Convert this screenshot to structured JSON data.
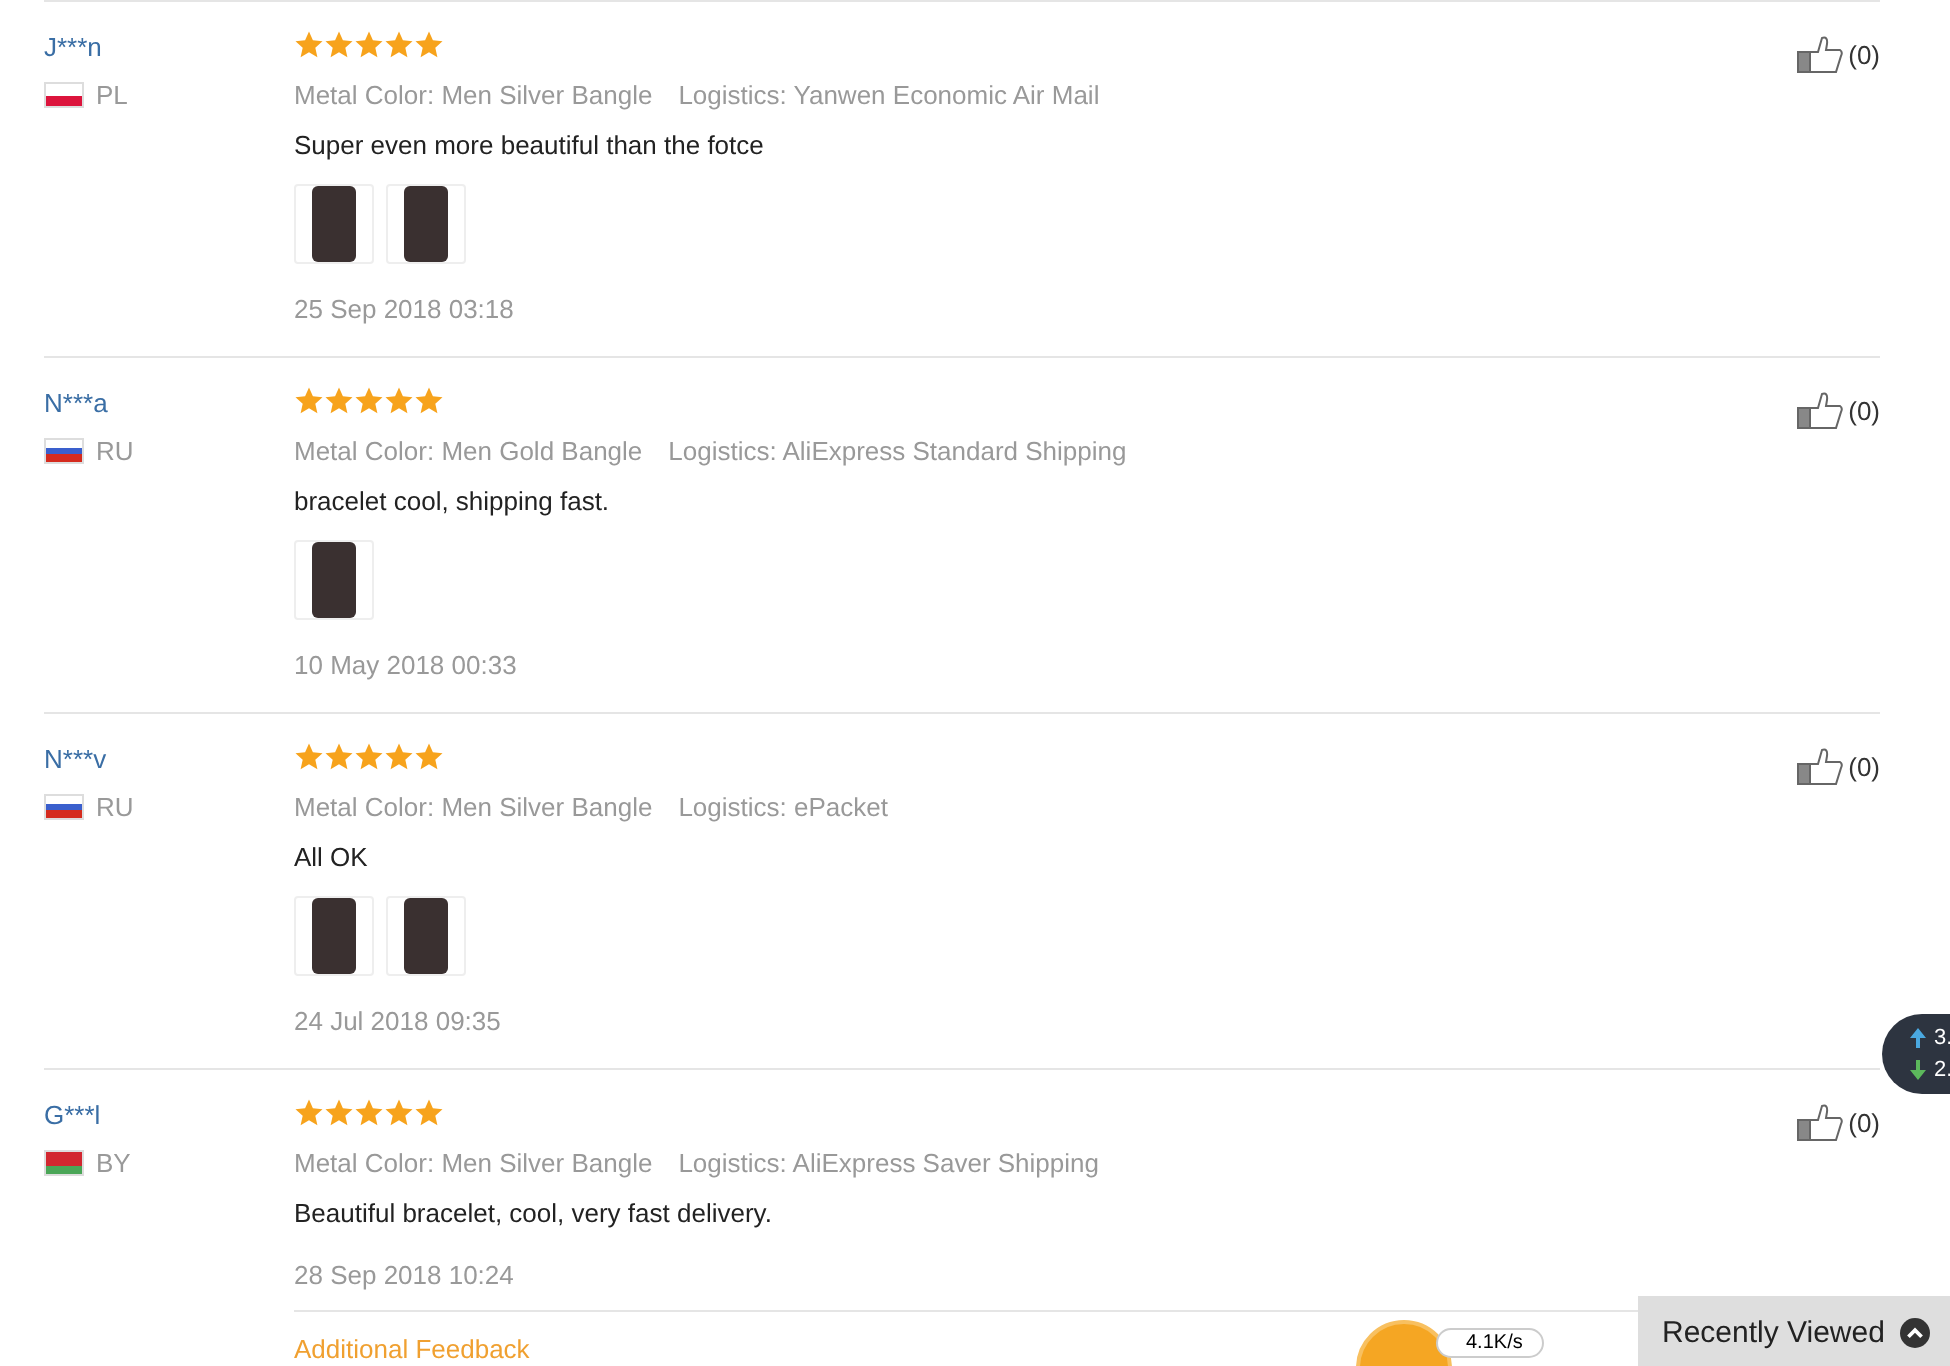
{
  "reviews": [
    {
      "name": "J***n",
      "flag": {
        "kind": "pl"
      },
      "country": "PL",
      "stars": 5,
      "attributes": [
        {
          "label": "Metal Color:",
          "value": "Men Silver Bangle"
        },
        {
          "label": "Logistics:",
          "value": "Yanwen Economic Air Mail"
        }
      ],
      "text": "Super even more beautiful than the fotce",
      "photos": [
        {
          "kind": "photo"
        },
        {
          "kind": "photo"
        }
      ],
      "date": "25 Sep 2018 03:18",
      "likes": "(0)"
    },
    {
      "name": "N***a",
      "flag": {
        "kind": "ru"
      },
      "country": "RU",
      "stars": 5,
      "attributes": [
        {
          "label": "Metal Color:",
          "value": "Men Gold Bangle"
        },
        {
          "label": "Logistics:",
          "value": "AliExpress Standard Shipping"
        }
      ],
      "text": "bracelet cool, shipping fast.",
      "photos": [
        {
          "kind": "photo"
        }
      ],
      "date": "10 May 2018 00:33",
      "likes": "(0)"
    },
    {
      "name": "N***v",
      "flag": {
        "kind": "ru"
      },
      "country": "RU",
      "stars": 5,
      "attributes": [
        {
          "label": "Metal Color:",
          "value": "Men Silver Bangle"
        },
        {
          "label": "Logistics:",
          "value": "ePacket"
        }
      ],
      "text": "All OK",
      "photos": [
        {
          "kind": "photo"
        },
        {
          "kind": "photo"
        }
      ],
      "date": "24 Jul 2018 09:35",
      "likes": "(0)"
    },
    {
      "name": "G***l",
      "flag": {
        "kind": "by"
      },
      "country": "BY",
      "stars": 5,
      "attributes": [
        {
          "label": "Metal Color:",
          "value": "Men Silver Bangle"
        },
        {
          "label": "Logistics:",
          "value": "AliExpress Saver Shipping"
        }
      ],
      "text": "Beautiful bracelet, cool, very fast delivery.",
      "date": "28 Sep 2018 10:24",
      "likes": "(0)",
      "additional_feedback": "Additional Feedback"
    }
  ],
  "speed_widget": {
    "upload": "3.",
    "download": "2."
  },
  "speed_ball": {
    "reading": "4.1K/s"
  },
  "recently_viewed": {
    "label": "Recently Viewed"
  }
}
